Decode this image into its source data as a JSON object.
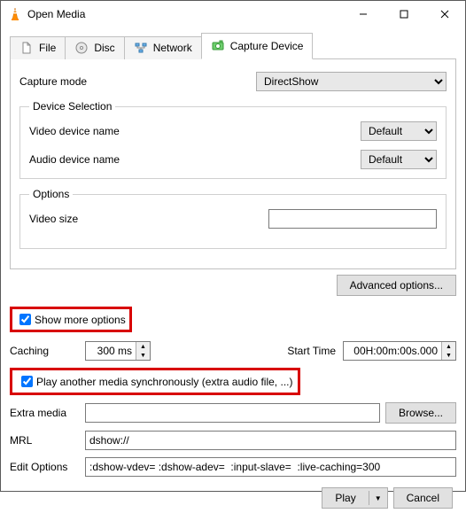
{
  "window": {
    "title": "Open Media"
  },
  "tabs": {
    "file": "File",
    "disc": "Disc",
    "network": "Network",
    "capture": "Capture Device"
  },
  "capture": {
    "mode_label": "Capture mode",
    "mode_value": "DirectShow",
    "device_selection_legend": "Device Selection",
    "video_device_label": "Video device name",
    "video_device_value": "Default",
    "audio_device_label": "Audio device name",
    "audio_device_value": "Default",
    "options_legend": "Options",
    "video_size_label": "Video size",
    "video_size_value": ""
  },
  "advanced_btn": "Advanced options...",
  "show_more_label": "Show more options",
  "more": {
    "caching_label": "Caching",
    "caching_value": "300 ms",
    "start_time_label": "Start Time",
    "start_time_value": "00H:00m:00s.000",
    "play_sync_label": "Play another media synchronously (extra audio file, ...)",
    "extra_media_label": "Extra media",
    "extra_media_value": "",
    "browse_btn": "Browse...",
    "mrl_label": "MRL",
    "mrl_value": "dshow://",
    "edit_options_label": "Edit Options",
    "edit_options_value": ":dshow-vdev= :dshow-adev=  :input-slave=  :live-caching=300"
  },
  "footer": {
    "play": "Play",
    "cancel": "Cancel"
  }
}
